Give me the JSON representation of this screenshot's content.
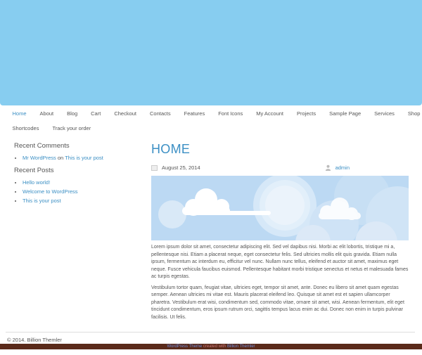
{
  "nav": {
    "row1": [
      "Home",
      "About",
      "Blog",
      "Cart",
      "Checkout",
      "Contacts",
      "Features",
      "Font Icons",
      "My Account",
      "Projects",
      "Sample Page",
      "Services",
      "Shop"
    ],
    "row2": [
      "Shortcodes",
      "Track your order"
    ]
  },
  "sidebar": {
    "recent_comments": {
      "title": "Recent Comments",
      "items": [
        {
          "author": "Mr WordPress",
          "on": "on",
          "post": "This is your post"
        }
      ]
    },
    "recent_posts": {
      "title": "Recent Posts",
      "items": [
        "Hello world!",
        "Welcome to WordPress",
        "This is your post"
      ]
    }
  },
  "post": {
    "title": "HOME",
    "date": "August 25, 2014",
    "author": "admin",
    "paragraphs": [
      "Lorem ipsum dolor sit amet, consectetur adipiscing elit. Sed vel dapibus nisi. Morbi ac elit lobortis, tristique mi a, pellentesque nisi. Etiam a placerat neque, eget consectetur felis. Sed ultricies mollis elit quis gravida. Etiam nulla ipsum, fermentum ac interdum eu, efficitur vel nunc. Nullam nunc tellus, eleifend et auctor sit amet, maximus eget neque. Fusce vehicula faucibus euismod. Pellentesque habitant morbi tristique senectus et netus et malesuada fames ac turpis egestas.",
      "Vestibulum tortor quam, feugiat vitae, ultricies eget, tempor sit amet, ante. Donec eu libero sit amet quam egestas semper. Aenean ultricies mi vitae est. Mauris placerat eleifend leo. Quisque sit amet est et sapien ullamcorper pharetra. Vestibulum erat wisi, condimentum sed, commodo vitae, ornare sit amet, wisi. Aenean fermentum, elit eget tincidunt condimentum, eros ipsum rutrum orci, sagittis tempus lacus enim ac dui. Donec non enim in turpis pulvinar facilisis. Ut felis."
    ]
  },
  "footer": {
    "copyright": "© 2014. Billion Themler",
    "bar_link1": "WordPress Theme",
    "bar_mid": "created with",
    "bar_link2": "Billion Themler"
  },
  "colors": {
    "header": "#87cdf0",
    "link": "#3b8fc4",
    "bar": "#5a2a1a"
  },
  "icons": {
    "date": "calendar-icon",
    "author": "user-icon"
  }
}
